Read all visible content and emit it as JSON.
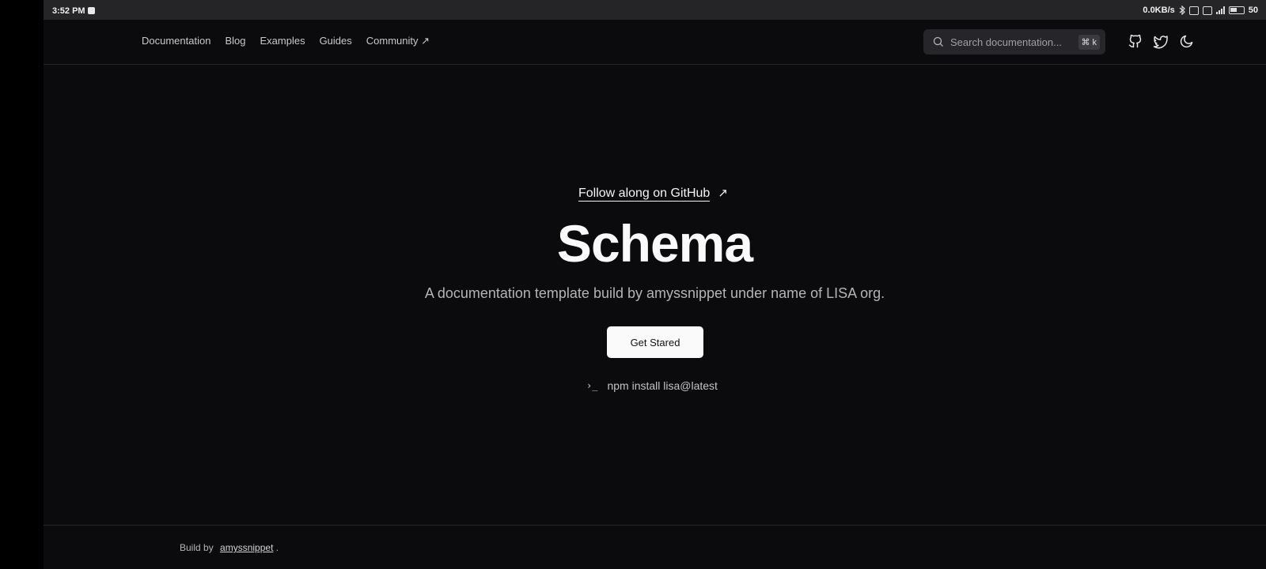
{
  "status_bar": {
    "time": "3:52 PM",
    "network_speed": "0.0KB/s",
    "battery": "50"
  },
  "nav": {
    "items": [
      {
        "label": "Documentation"
      },
      {
        "label": "Blog"
      },
      {
        "label": "Examples"
      },
      {
        "label": "Guides"
      },
      {
        "label": "Community ↗"
      }
    ]
  },
  "search": {
    "placeholder": "Search documentation...",
    "shortcut_symbol": "⌘",
    "shortcut_key": "k"
  },
  "header_icons": [
    "github-icon",
    "twitter-icon",
    "moon-icon"
  ],
  "hero": {
    "link_label": "Follow along on GitHub",
    "link_arrow": "↗",
    "title": "Schema",
    "subtitle": "A documentation template build by amyssnippet under name of LISA org.",
    "cta_label": "Get Stared",
    "install_prompt": "›_",
    "install_command": "npm install lisa@latest"
  },
  "footer": {
    "prefix": "Build by",
    "author": "amyssnippet",
    "suffix": "."
  },
  "colors": {
    "background": "#0b0b0d",
    "status_bar": "#252528",
    "text": "#fafafa",
    "muted": "#b4b4b8",
    "button_bg": "#fafafa"
  }
}
